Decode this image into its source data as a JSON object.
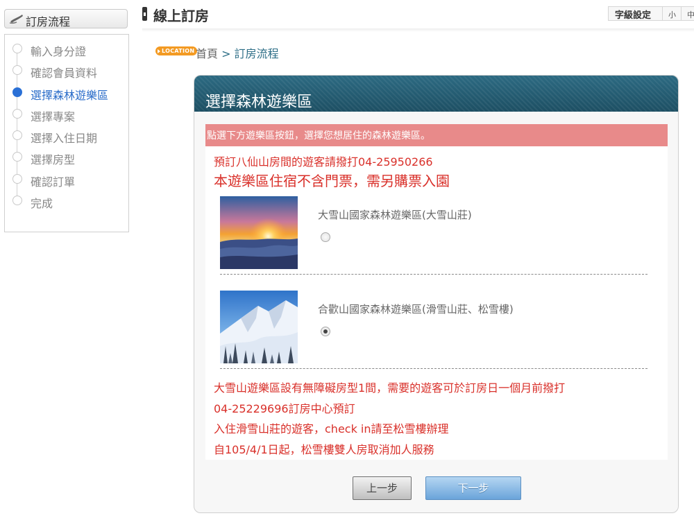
{
  "sidebar": {
    "title": "訂房流程",
    "steps": [
      {
        "label": "輸入身分證",
        "active": false
      },
      {
        "label": "確認會員資料",
        "active": false
      },
      {
        "label": "選擇森林遊樂區",
        "active": true
      },
      {
        "label": "選擇專案",
        "active": false
      },
      {
        "label": "選擇入住日期",
        "active": false
      },
      {
        "label": "選擇房型",
        "active": false
      },
      {
        "label": "確認訂單",
        "active": false
      },
      {
        "label": "完成",
        "active": false
      }
    ]
  },
  "header": {
    "title": "線上訂房",
    "font_setting": {
      "label": "字級設定",
      "small": "小",
      "medium": "中"
    }
  },
  "breadcrumb": {
    "badge": "LOCATION",
    "home": "首頁",
    "separator": ">",
    "current": "訂房流程"
  },
  "panel": {
    "title": "選擇森林遊樂區",
    "instruction": "點選下方遊樂區按鈕，選擇您想居住的森林遊樂區。",
    "contact_notice": "預訂八仙山房間的遊客請撥打04-25950266",
    "ticket_notice": "本遊樂區住宿不含門票，需另購票入園",
    "parks": [
      {
        "name": "大雪山國家森林遊樂區(大雪山莊)",
        "selected": false,
        "image": "sunset-sea-of-clouds-photo"
      },
      {
        "name": "合歡山國家森林遊樂區(滑雪山莊、松雪樓)",
        "selected": true,
        "image": "snowy-mountain-photo"
      }
    ],
    "notes": [
      "大雪山遊樂區設有無障礙房型1間，需要的遊客可於訂房日一個月前撥打",
      "04-25229696訂房中心預訂",
      "入住滑雪山莊的遊客，check in請至松雪樓辦理",
      "自105/4/1日起，松雪樓雙人房取消加人服務"
    ],
    "buttons": {
      "prev": "上一步",
      "next": "下一步"
    }
  },
  "colors": {
    "panel_header": "#1d4f63",
    "notice_bar": "#e88a8a",
    "notice_text": "#d9302a",
    "active_step": "#2b6dc9",
    "location_badge": "#f39a22"
  }
}
